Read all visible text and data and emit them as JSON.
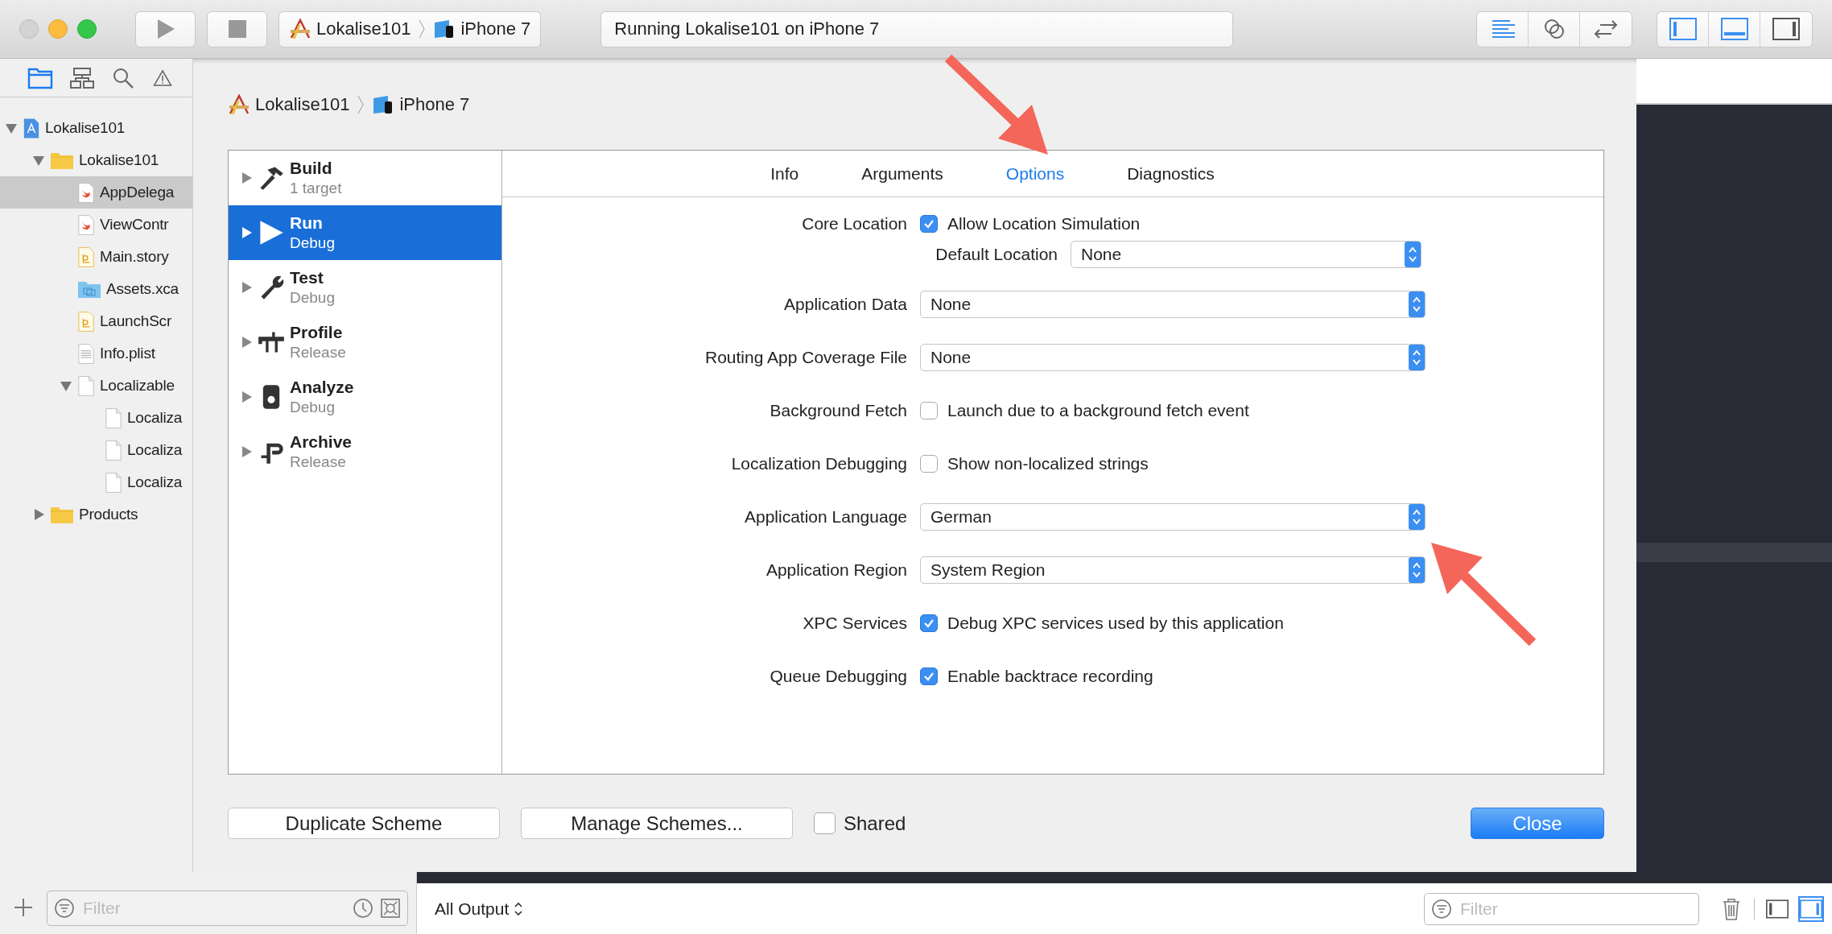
{
  "toolbar": {
    "scheme": {
      "target": "Lokalise101",
      "device": "iPhone 7"
    },
    "activity": "Running Lokalise101 on iPhone 7",
    "editor_modes": [
      {
        "kind": "standard",
        "selected": true
      },
      {
        "kind": "assistant",
        "selected": false
      },
      {
        "kind": "version",
        "selected": false
      }
    ],
    "panels": [
      {
        "kind": "navigator",
        "on": true
      },
      {
        "kind": "debug",
        "on": true
      },
      {
        "kind": "utilities",
        "on": false
      }
    ]
  },
  "navigator": {
    "tree": [
      {
        "name": "Lokalise101",
        "kind": "project",
        "selected": false,
        "expanded": true,
        "children": [
          {
            "name": "Lokalise101",
            "kind": "folder",
            "selected": false,
            "expanded": true,
            "children": [
              {
                "name": "AppDelega",
                "kind": "swift",
                "selected": true
              },
              {
                "name": "ViewContr",
                "kind": "swift",
                "selected": false
              },
              {
                "name": "Main.story",
                "kind": "storyboard",
                "selected": false
              },
              {
                "name": "Assets.xca",
                "kind": "assets",
                "selected": false
              },
              {
                "name": "LaunchScr",
                "kind": "storyboard",
                "selected": false
              },
              {
                "name": "Info.plist",
                "kind": "plist",
                "selected": false
              },
              {
                "name": "Localizable",
                "kind": "file",
                "selected": false,
                "expanded": true,
                "children": [
                  {
                    "name": "Localiza",
                    "kind": "file",
                    "selected": false
                  },
                  {
                    "name": "Localiza",
                    "kind": "file",
                    "selected": false
                  },
                  {
                    "name": "Localiza",
                    "kind": "file",
                    "selected": false
                  }
                ]
              }
            ]
          },
          {
            "name": "Products",
            "kind": "folder",
            "selected": false,
            "expanded": false
          }
        ]
      }
    ],
    "filter": {
      "placeholder": "Filter"
    }
  },
  "sheet": {
    "breadcrumb": {
      "target": "Lokalise101",
      "device": "iPhone 7"
    },
    "actions": [
      {
        "name": "Build",
        "detail": "1 target",
        "kind": "build",
        "selected": false
      },
      {
        "name": "Run",
        "detail": "Debug",
        "kind": "run",
        "selected": true
      },
      {
        "name": "Test",
        "detail": "Debug",
        "kind": "test",
        "selected": false
      },
      {
        "name": "Profile",
        "detail": "Release",
        "kind": "profile",
        "selected": false
      },
      {
        "name": "Analyze",
        "detail": "Debug",
        "kind": "analyze",
        "selected": false
      },
      {
        "name": "Archive",
        "detail": "Release",
        "kind": "archive",
        "selected": false
      }
    ],
    "tabs": [
      {
        "label": "Info",
        "selected": false
      },
      {
        "label": "Arguments",
        "selected": false
      },
      {
        "label": "Options",
        "selected": true
      },
      {
        "label": "Diagnostics",
        "selected": false
      }
    ],
    "options": [
      {
        "kind": "checkbox",
        "label": "Core Location",
        "checked": true,
        "text": "Allow Location Simulation"
      },
      {
        "kind": "subpopup",
        "label": "Default Location",
        "value": "None"
      },
      {
        "kind": "popup",
        "label": "Application Data",
        "value": "None"
      },
      {
        "kind": "popup",
        "label": "Routing App Coverage File",
        "value": "None"
      },
      {
        "kind": "checkbox",
        "label": "Background Fetch",
        "checked": false,
        "text": "Launch due to a background fetch event"
      },
      {
        "kind": "checkbox",
        "label": "Localization Debugging",
        "checked": false,
        "text": "Show non-localized strings"
      },
      {
        "kind": "popup",
        "label": "Application Language",
        "value": "German"
      },
      {
        "kind": "popup",
        "label": "Application Region",
        "value": "System Region"
      },
      {
        "kind": "checkbox",
        "label": "XPC Services",
        "checked": true,
        "text": "Debug XPC services used by this application"
      },
      {
        "kind": "checkbox",
        "label": "Queue Debugging",
        "checked": true,
        "text": "Enable backtrace recording"
      }
    ],
    "buttons": {
      "duplicate": "Duplicate Scheme",
      "manage": "Manage Schemes...",
      "close": "Close"
    },
    "shared": {
      "label": "Shared",
      "checked": false
    }
  },
  "console": {
    "output": "All Output",
    "filter": {
      "placeholder": "Filter"
    },
    "views": [
      {
        "kind": "left",
        "on": false
      },
      {
        "kind": "right",
        "on": true
      }
    ]
  }
}
